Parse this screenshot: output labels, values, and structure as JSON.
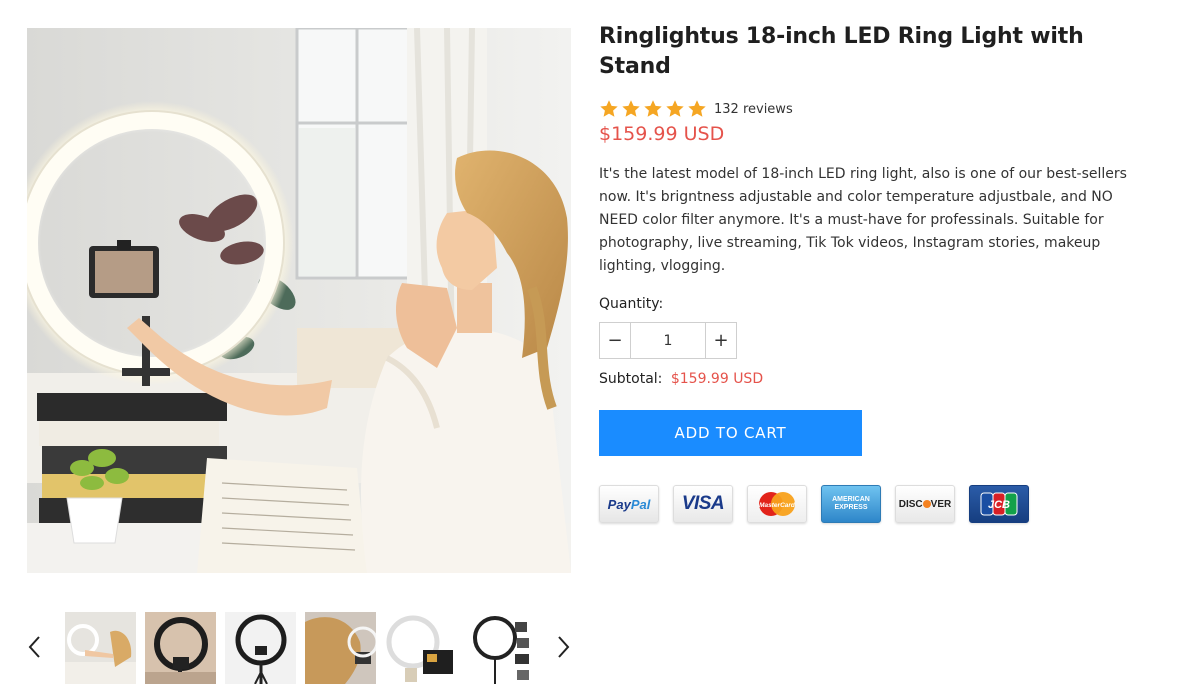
{
  "product": {
    "title": "Ringlightus 18-inch LED Ring Light with Stand",
    "rating_stars": 5,
    "reviews": "132 reviews",
    "price": "$159.99 USD",
    "description": "It's the latest model of 18-inch LED ring light, also is one of our best-sellers now. It's brigntness adjustable and color temperature adjustbale, and NO NEED color filter anymore. It's a must-have for professinals. Suitable for photography, live streaming, Tik Tok videos, Instagram stories, makeup lighting, vlogging."
  },
  "quantity": {
    "label": "Quantity:",
    "value": "1",
    "minus": "−",
    "plus": "+"
  },
  "subtotal": {
    "label": "Subtotal:",
    "value": "$159.99 USD"
  },
  "cart": {
    "label": "ADD TO CART"
  },
  "payments": {
    "paypal_pay": "Pay",
    "paypal_pal": "Pal",
    "visa": "VISA",
    "mastercard": "MasterCard",
    "amex_1": "AMERICAN",
    "amex_2": "EXPRESS",
    "discover_1": "DISC",
    "discover_2": "VER",
    "jcb": "JCB"
  },
  "gallery": {
    "thumbnail_count": 6,
    "prev_icon": "chevron-left-icon",
    "next_icon": "chevron-right-icon"
  },
  "colors": {
    "price": "#e5534b",
    "cart_button": "#1a8cff",
    "star": "#f5a623"
  }
}
